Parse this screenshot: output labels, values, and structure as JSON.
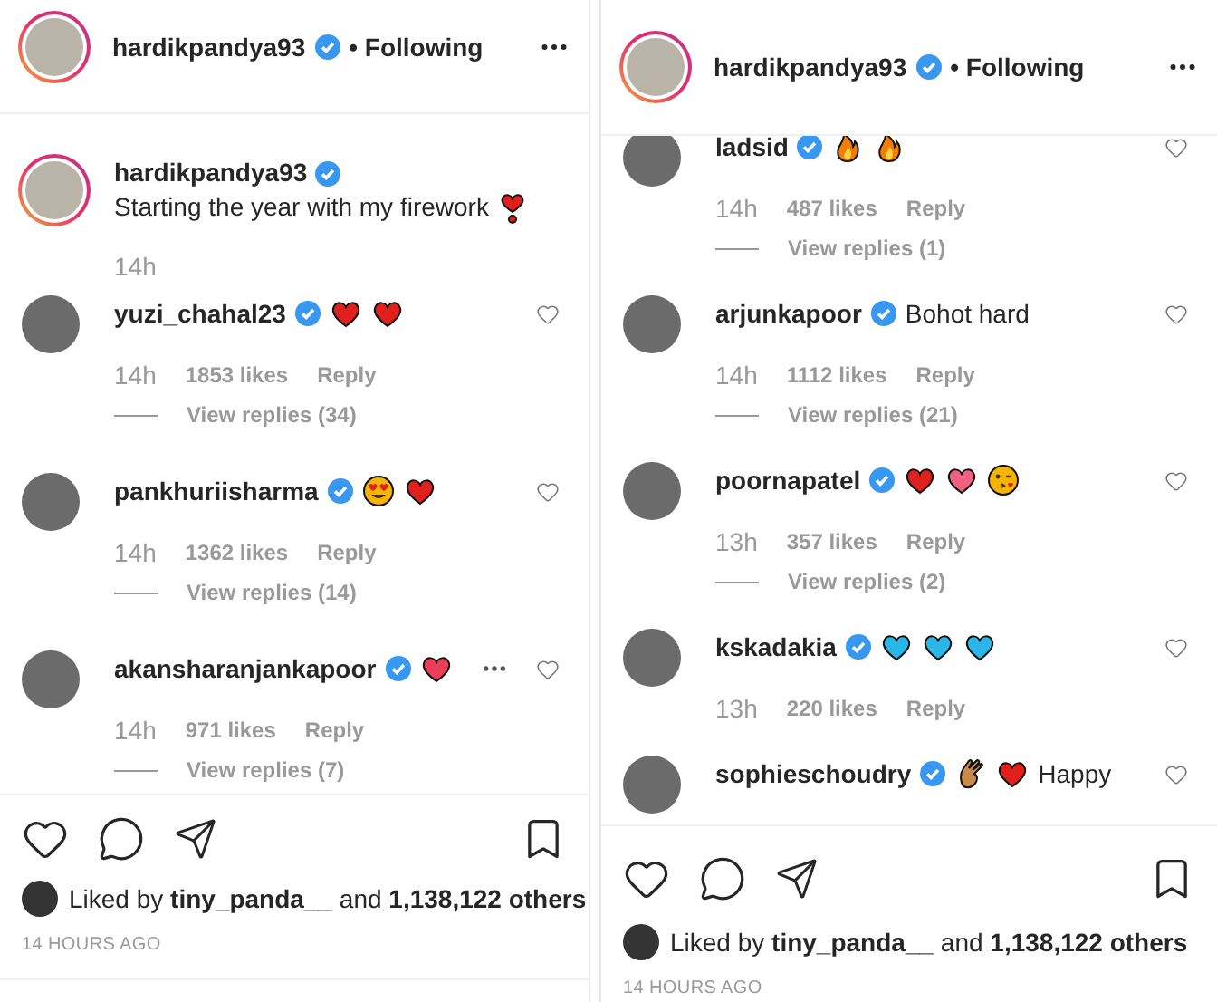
{
  "panels": [
    {
      "header": {
        "username": "hardikpandya93",
        "verified": true,
        "status": "• Following"
      },
      "caption": {
        "username": "hardikpandya93",
        "verified": true,
        "text": "Starting the year with my firework",
        "emojis": [
          {
            "kind": "heart-exclamation",
            "color": "#e0201c"
          }
        ],
        "time": "14h"
      },
      "comments": [
        {
          "username": "yuzi_chahal23",
          "verified": true,
          "emojis": [
            {
              "kind": "heart",
              "color": "#e0201c"
            },
            {
              "kind": "heart",
              "color": "#e0201c"
            }
          ],
          "more": false,
          "time": "14h",
          "likes": "1853 likes",
          "reply": "Reply",
          "view_replies": "View replies (34)"
        },
        {
          "username": "pankhuriisharma",
          "verified": true,
          "emojis": [
            {
              "kind": "heart-eyes",
              "color": "#f5b400"
            },
            {
              "kind": "heart",
              "color": "#e0201c"
            }
          ],
          "more": false,
          "time": "14h",
          "likes": "1362 likes",
          "reply": "Reply",
          "view_replies": "View replies (14)"
        },
        {
          "username": "akansharanjankapoor",
          "verified": true,
          "emojis": [
            {
              "kind": "heart",
              "color": "#e8405a"
            }
          ],
          "more": true,
          "time": "14h",
          "likes": "971 likes",
          "reply": "Reply",
          "view_replies": "View replies (7)"
        }
      ],
      "liked_by": "Liked by **tiny_panda__** and **1,138,122 others**",
      "timestamp": "14 HOURS AGO"
    },
    {
      "header": {
        "username": "hardikpandya93",
        "verified": true,
        "status": "• Following"
      },
      "comments": [
        {
          "username": "ladsid",
          "verified": true,
          "emojis": [
            {
              "kind": "fire",
              "color": "#f57c00"
            },
            {
              "kind": "fire",
              "color": "#f57c00"
            }
          ],
          "more": false,
          "time": "14h",
          "likes": "487 likes",
          "reply": "Reply",
          "view_replies": "View replies (1)"
        },
        {
          "username": "arjunkapoor",
          "verified": true,
          "text": "Bohot hard",
          "more": false,
          "time": "14h",
          "likes": "1112 likes",
          "reply": "Reply",
          "view_replies": "View replies (21)"
        },
        {
          "username": "poornapatel",
          "verified": true,
          "emojis": [
            {
              "kind": "heart",
              "color": "#e0201c"
            },
            {
              "kind": "heart",
              "color": "#f06080"
            },
            {
              "kind": "kiss-wink",
              "color": "#f5b400"
            }
          ],
          "more": false,
          "time": "13h",
          "likes": "357 likes",
          "reply": "Reply",
          "view_replies": "View replies (2)"
        },
        {
          "username": "kskadakia",
          "verified": true,
          "emojis": [
            {
              "kind": "heart",
              "color": "#2ab6e8"
            },
            {
              "kind": "heart",
              "color": "#2ab6e8"
            },
            {
              "kind": "heart",
              "color": "#2ab6e8"
            }
          ],
          "more": false,
          "time": "13h",
          "likes": "220 likes",
          "reply": "Reply"
        },
        {
          "username": "sophieschoudry",
          "verified": true,
          "text": "Happy",
          "emojis": [
            {
              "kind": "clap",
              "color": "#c88a4a"
            },
            {
              "kind": "heart",
              "color": "#e0201c"
            }
          ],
          "more": false
        }
      ],
      "liked_by": "Liked by **tiny_panda__** and **1,138,122 others**",
      "timestamp": "14 HOURS AGO"
    }
  ]
}
